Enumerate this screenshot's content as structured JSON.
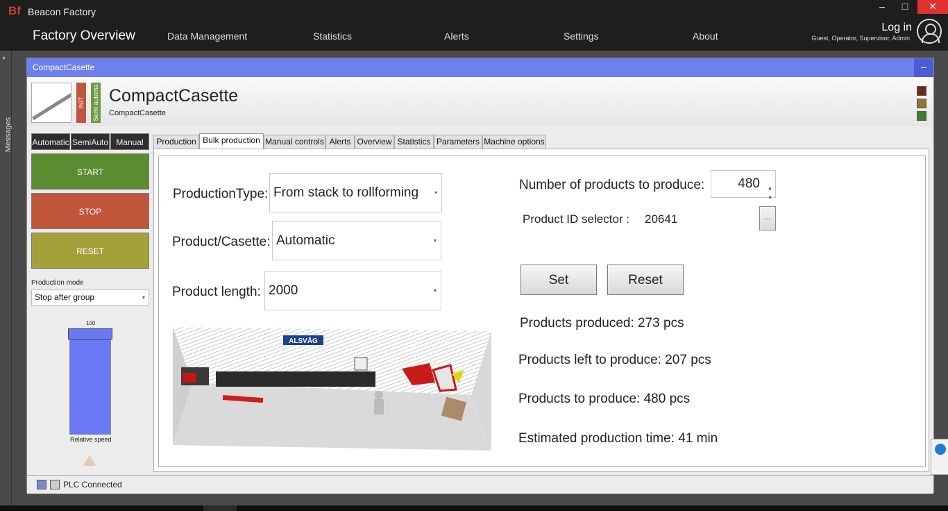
{
  "app": {
    "logo": "Bf",
    "title": "Beacon Factory"
  },
  "window_controls": {
    "minimize": "–",
    "maximize": "□",
    "close": "✕"
  },
  "nav": {
    "items": [
      {
        "label": "Factory Overview"
      },
      {
        "label": "Data Management"
      },
      {
        "label": "Statistics"
      },
      {
        "label": "Alerts"
      },
      {
        "label": "Settings"
      },
      {
        "label": "About"
      }
    ],
    "login": "Log in",
    "roles": "Guest, Operator, Supervisor, Admin"
  },
  "messages_tab": {
    "arrow": "▸",
    "label": "Messages"
  },
  "panel": {
    "header": "CompactCasette",
    "minimize": "–",
    "machine_title": "CompactCasette",
    "machine_subtitle": "CompactCasette",
    "state_labels": [
      "INIT",
      "Semi automa"
    ],
    "colors": {
      "init": "#c0563e",
      "semi": "#6c9a46",
      "legend": [
        "#6e2a1e",
        "#8a7a35",
        "#3e7d2e"
      ]
    }
  },
  "controls": {
    "mode_tabs": [
      "Automatic",
      "SemiAuto",
      "Manual"
    ],
    "start": "START",
    "stop": "STOP",
    "reset": "RESET",
    "colors": {
      "start": "#5b8c32",
      "stop": "#c0553a",
      "reset": "#a5a13a"
    },
    "production_mode_label": "Production mode",
    "production_mode_value": "Stop after group",
    "speed_max": "100",
    "speed_label": "Relative speed",
    "speed_level_percent": 100
  },
  "tabs": [
    "Production",
    "Bulk production",
    "Manual controls",
    "Alerts",
    "Overview",
    "Statistics",
    "Parameters",
    "Machine options"
  ],
  "active_tab": "Bulk production",
  "bulk": {
    "production_type_label": "ProductionType:",
    "production_type_value": "From stack to rollforming",
    "product_casette_label": "Product/Casette:",
    "product_casette_value": "Automatic",
    "product_length_label": "Product length:",
    "product_length_value": "2000",
    "num_products_label": "Number of products to produce:",
    "num_products_value": "480",
    "product_id_label": "Product ID selector  :",
    "product_id_value": "20641",
    "ellipsis": "...",
    "set_button": "Set",
    "reset_button": "Reset",
    "products_produced": "Products produced: 273 pcs",
    "products_left": "Products left to produce: 207 pcs",
    "products_to_produce": "Products to produce: 480 pcs",
    "estimated_time": "Estimated production time: 41 min",
    "diagram_brand": "ALSVÅG"
  },
  "status": {
    "plc": "PLC Connected"
  },
  "icons": {
    "caret": "▾",
    "spin_up": "▲",
    "spin_down": "▼"
  }
}
